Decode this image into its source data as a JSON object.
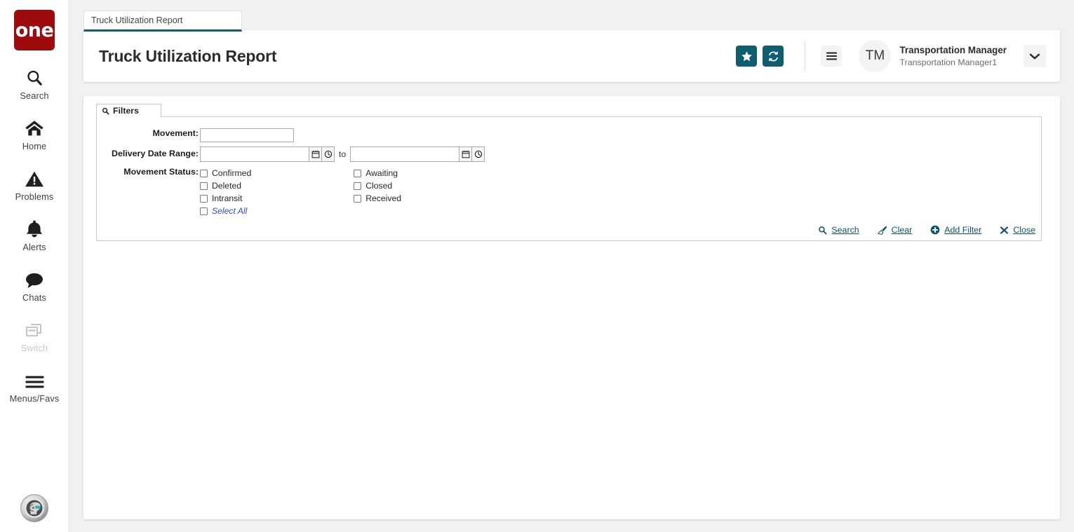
{
  "app": {
    "brand_logo_text": "one",
    "brand_color": "#9d0b0d",
    "accent_color": "#0e5d70",
    "link_color": "#0d5469",
    "select_all_color": "#2b4fd6"
  },
  "sidebar": {
    "items": [
      {
        "label": "Search",
        "icon": "search-icon",
        "disabled": false
      },
      {
        "label": "Home",
        "icon": "home-icon",
        "disabled": false
      },
      {
        "label": "Problems",
        "icon": "warning-icon",
        "disabled": false
      },
      {
        "label": "Alerts",
        "icon": "bell-icon",
        "disabled": false
      },
      {
        "label": "Chats",
        "icon": "chat-icon",
        "disabled": false
      },
      {
        "label": "Switch",
        "icon": "switch-icon",
        "disabled": true
      },
      {
        "label": "Menus/Favs",
        "icon": "hamburger-icon",
        "disabled": false
      }
    ],
    "bottom_icon": "ai-assistant-icon"
  },
  "tabstrip": {
    "tabs": [
      {
        "label": "Truck Utilization Report",
        "active": true
      }
    ]
  },
  "header": {
    "title": "Truck Utilization Report",
    "favorite_icon": "star-icon",
    "refresh_icon": "refresh-icon",
    "menu_icon": "hamburger-icon",
    "avatar_initials": "TM",
    "user_name": "Transportation Manager",
    "user_sub": "Transportation Manager1",
    "caret_icon": "chevron-down-icon"
  },
  "filters": {
    "tab_label": "Filters",
    "tab_icon": "search-icon",
    "fields": {
      "movement": {
        "label": "Movement:",
        "value": "",
        "placeholder": ""
      },
      "delivery_date_range": {
        "label": "Delivery Date Range:",
        "from_value": "",
        "from_placeholder": "",
        "to_word": "to",
        "to_value": "",
        "to_placeholder": "",
        "calendar_icon": "calendar-icon",
        "clock_icon": "clock-icon"
      },
      "movement_status": {
        "label": "Movement Status:",
        "column1": [
          {
            "label": "Confirmed",
            "checked": false,
            "style": "normal"
          },
          {
            "label": "Deleted",
            "checked": false,
            "style": "normal"
          },
          {
            "label": "Intransit",
            "checked": false,
            "style": "normal"
          },
          {
            "label": "Select All",
            "checked": false,
            "style": "link"
          }
        ],
        "column2": [
          {
            "label": "Awaiting",
            "checked": false,
            "style": "normal"
          },
          {
            "label": "Closed",
            "checked": false,
            "style": "normal"
          },
          {
            "label": "Received",
            "checked": false,
            "style": "normal"
          }
        ]
      }
    },
    "actions": [
      {
        "label": "Search",
        "icon": "search-icon"
      },
      {
        "label": "Clear",
        "icon": "eraser-icon"
      },
      {
        "label": "Add Filter",
        "icon": "plus-circle-icon"
      },
      {
        "label": "Close",
        "icon": "close-x-icon"
      }
    ]
  }
}
